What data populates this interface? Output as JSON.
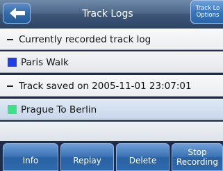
{
  "header": {
    "title": "Track Logs",
    "options_label_line1": "Track Lo",
    "options_label_line2": "Options"
  },
  "list": {
    "rows": [
      {
        "type": "group",
        "label": "Currently recorded track log"
      },
      {
        "type": "item",
        "label": "Paris Walk",
        "color": "#1f3fe8"
      },
      {
        "type": "group",
        "label": "Track saved on 2005-11-01 23:07:01"
      },
      {
        "type": "item",
        "label": "Prague To Berlin",
        "color": "#3ee08a"
      }
    ]
  },
  "toolbar": {
    "info": "Info",
    "replay": "Replay",
    "delete": "Delete",
    "stop_line1": "Stop",
    "stop_line2": "Recording"
  },
  "colors": {
    "header_bg": "#3d5677",
    "button_blue": "#3a73b6",
    "paris_walk": "#1f3fe8",
    "prague_to_berlin": "#3ee08a"
  },
  "icons": {
    "back": "back-arrow-icon"
  }
}
